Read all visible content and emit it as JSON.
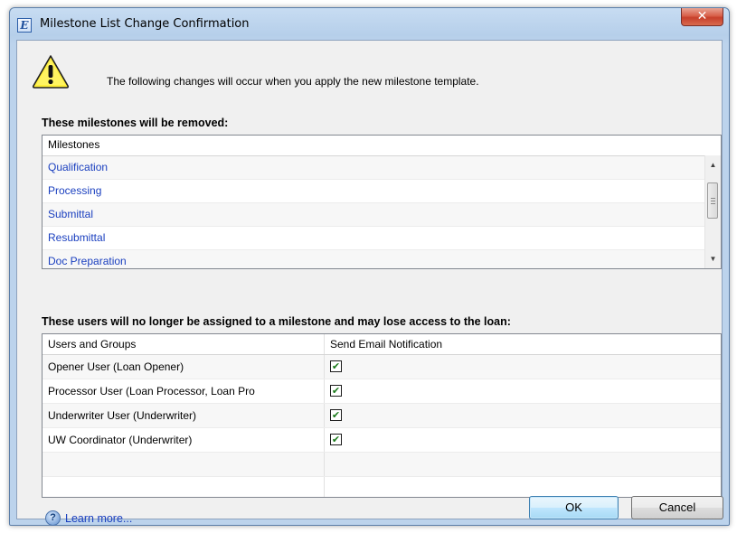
{
  "window": {
    "title": "Milestone List Change Confirmation",
    "app_icon_letter": "E",
    "close_glyph": "✕"
  },
  "intro": {
    "icon": "warning-icon",
    "text": "The following changes will occur when you apply the new milestone template."
  },
  "removed": {
    "heading": "These milestones will be removed:",
    "column_header": "Milestones",
    "items": [
      "Qualification",
      "Processing",
      "Submittal",
      "Resubmittal",
      "Doc Preparation"
    ]
  },
  "users": {
    "heading": "These users will no longer be assigned to a milestone and may lose access to the loan:",
    "columns": [
      "Users and Groups",
      "Send Email Notification"
    ],
    "rows": [
      {
        "name": "Opener User (Loan Opener)",
        "notify": true
      },
      {
        "name": "Processor User (Loan Processor, Loan Pro",
        "notify": true
      },
      {
        "name": "Underwriter User (Underwriter)",
        "notify": true
      },
      {
        "name": "UW Coordinator (Underwriter)",
        "notify": true
      }
    ]
  },
  "footer": {
    "help_icon": "help-icon",
    "help_glyph": "?",
    "help_label": "Learn more...",
    "ok_label": "OK",
    "cancel_label": "Cancel"
  },
  "colors": {
    "link": "#1a3fbf",
    "check": "#1a7a1a",
    "warning_fill": "#ffef3a"
  }
}
